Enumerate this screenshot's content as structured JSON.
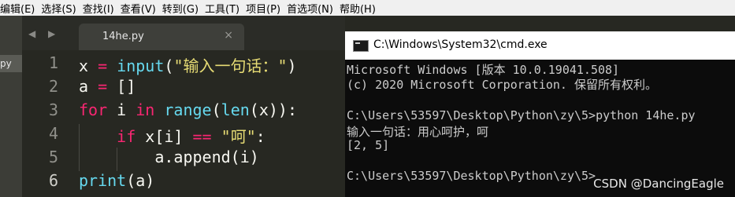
{
  "menubar": {
    "items": [
      "编辑(E)",
      "选择(S)",
      "查找(I)",
      "查看(V)",
      "转到(G)",
      "工具(T)",
      "项目(P)",
      "首选项(N)",
      "帮助(H)"
    ]
  },
  "sidebar": {
    "tab_label": "py"
  },
  "editor": {
    "nav_arrows": "◀ ▶",
    "tab": {
      "label": "14he.py",
      "close": "×"
    },
    "line_numbers": [
      "1",
      "2",
      "3",
      "4",
      "5",
      "6"
    ],
    "code": {
      "l1": {
        "a": "x ",
        "b": "=",
        "c": " ",
        "d": "input",
        "e": "(",
        "f": "\"输入一句话：\"",
        "g": ")"
      },
      "l2": {
        "a": "a ",
        "b": "=",
        "c": " []"
      },
      "l3": {
        "a": "for",
        "b": " i ",
        "c": "in",
        "d": " ",
        "e": "range",
        "f": "(",
        "g": "len",
        "h": "(x)):"
      },
      "l4": {
        "a": "    ",
        "b": "if",
        "c": " x[i] ",
        "d": "==",
        "e": " ",
        "f": "\"呵\"",
        "g": ":"
      },
      "l5": {
        "a": "        a.append(i)"
      },
      "l6": {
        "a": "print",
        "b": "(a)"
      }
    }
  },
  "cmd": {
    "title": "C:\\Windows\\System32\\cmd.exe",
    "lines": [
      "Microsoft Windows [版本 10.0.19041.508]",
      "(c) 2020 Microsoft Corporation. 保留所有权利。",
      "",
      "C:\\Users\\53597\\Desktop\\Python\\zy\\5>python 14he.py",
      "输入一句话：用心呵护，呵",
      "[2, 5]",
      "",
      "C:\\Users\\53597\\Desktop\\Python\\zy\\5>"
    ]
  },
  "watermark": "CSDN @DancingEagle"
}
